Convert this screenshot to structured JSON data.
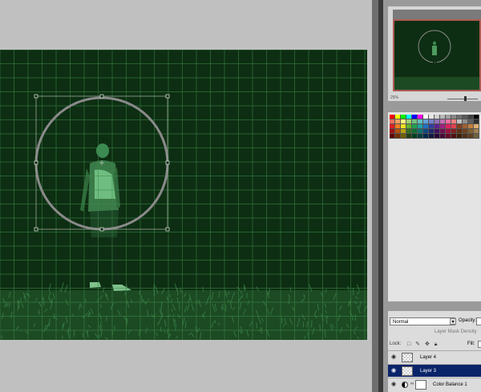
{
  "colors": {
    "canvas_bg": "#0d2e12",
    "grid": "#3f8a4a",
    "circle": "#8a8a8a",
    "selection": "#0a246a",
    "proxy_border": "#e03c2a"
  },
  "navigator": {
    "zoom": "25%"
  },
  "swatches": [
    "#ff0000",
    "#ffff00",
    "#00ff00",
    "#00ffff",
    "#0000ff",
    "#ff00ff",
    "#ffffff",
    "#e6e6e6",
    "#d0d0d0",
    "#b8b8b8",
    "#a0a0a0",
    "#888888",
    "#707070",
    "#585858",
    "#404040",
    "#000000",
    "#f07060",
    "#f4a060",
    "#fcf080",
    "#a0d070",
    "#70c080",
    "#60c0c0",
    "#60a0d8",
    "#7080c8",
    "#9070b8",
    "#c070b0",
    "#f070a0",
    "#f08080",
    "#c0c0c0",
    "#909090",
    "#606060",
    "#303030",
    "#e02020",
    "#f08020",
    "#f8e020",
    "#60b030",
    "#20a050",
    "#20a0a0",
    "#2070c0",
    "#3040a0",
    "#602090",
    "#a02080",
    "#e02060",
    "#e04050",
    "#804020",
    "#a06030",
    "#c08040",
    "#e0b070",
    "#a01010",
    "#b05010",
    "#b8a010",
    "#307020",
    "#107030",
    "#107070",
    "#104880",
    "#202870",
    "#401060",
    "#701050",
    "#a01040",
    "#802020",
    "#603010",
    "#704020",
    "#806030",
    "#a08050",
    "#600000",
    "#703000",
    "#706000",
    "#204010",
    "#004020",
    "#004040",
    "#002850",
    "#101840",
    "#280838",
    "#480838",
    "#680828",
    "#501010",
    "#402008",
    "#503018",
    "#604020",
    "#706040"
  ],
  "layers": {
    "blend_mode": "Normal",
    "opacity_label": "Opacity:",
    "mask_density_label": "Layer Mask Density",
    "lock_label": "Lock:",
    "fill_label": "Fill:",
    "items": [
      {
        "name": "Layer 4"
      },
      {
        "name": "Layer 3"
      },
      {
        "name": "Color Balance 1"
      }
    ]
  }
}
